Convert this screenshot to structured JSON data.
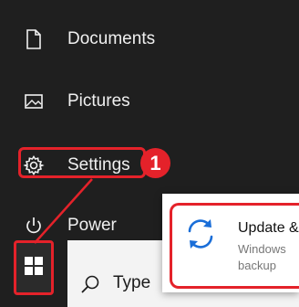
{
  "start_menu": {
    "items": [
      {
        "label": "Documents",
        "icon": "document-icon"
      },
      {
        "label": "Pictures",
        "icon": "pictures-icon"
      },
      {
        "label": "Settings",
        "icon": "gear-icon"
      },
      {
        "label": "Power",
        "icon": "power-icon"
      }
    ]
  },
  "annotation": {
    "step_number": "1",
    "color": "#e4222a"
  },
  "taskbar": {
    "start_icon": "windows-logo-icon",
    "search_icon": "search-icon",
    "search_text": "Type"
  },
  "popup": {
    "icon": "sync-icon",
    "title": "Update &",
    "subtitle_line1": "Windows",
    "subtitle_line2": "backup",
    "accent": "#1a6ed8"
  },
  "colors": {
    "background": "#1f1f1f",
    "text": "#f0f0f0",
    "search_bg": "#f3f3f3"
  }
}
